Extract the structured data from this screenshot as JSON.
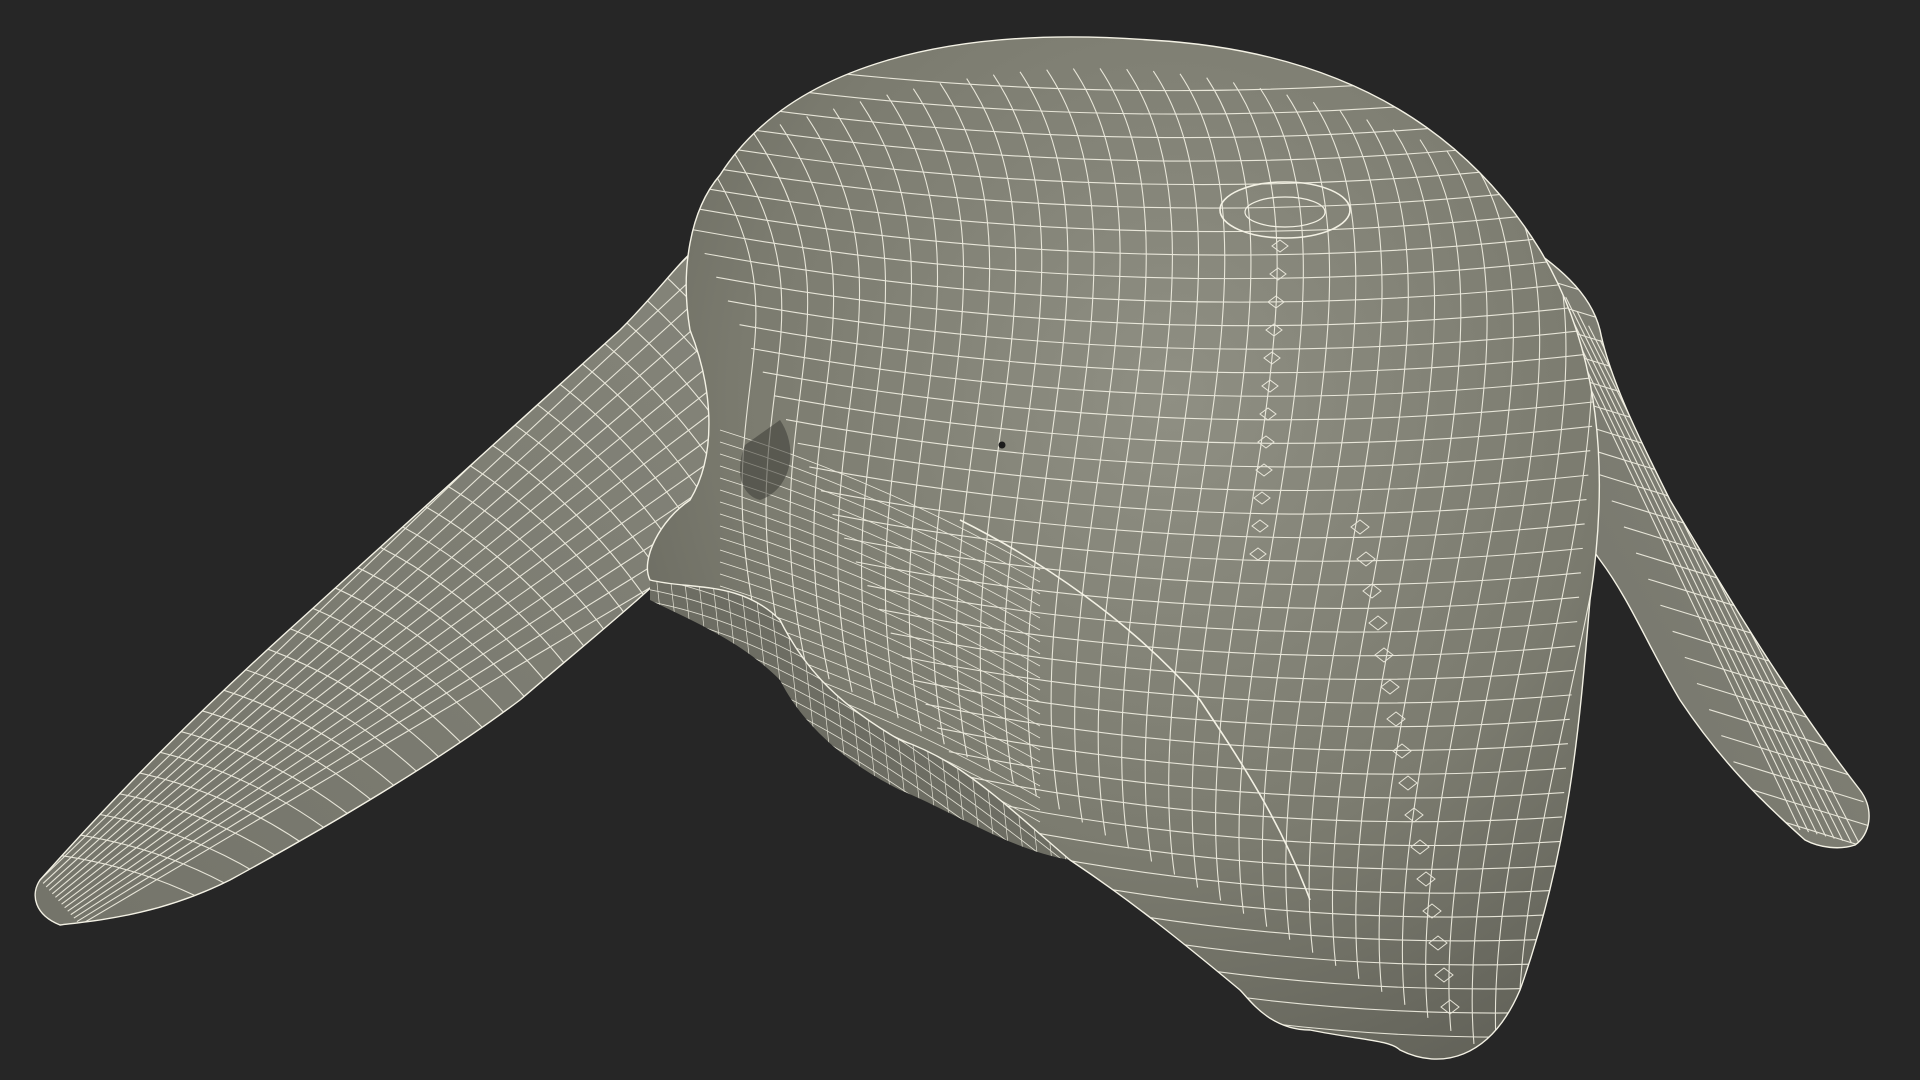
{
  "scene": {
    "subject": "whale-head-wireframe-mesh",
    "colors": {
      "background": "#262626",
      "mesh_fill": "#7e7e72",
      "mesh_fill_light": "#8d8d81",
      "mesh_shadow": "#55554c",
      "wire": "#f3f1e4"
    }
  }
}
